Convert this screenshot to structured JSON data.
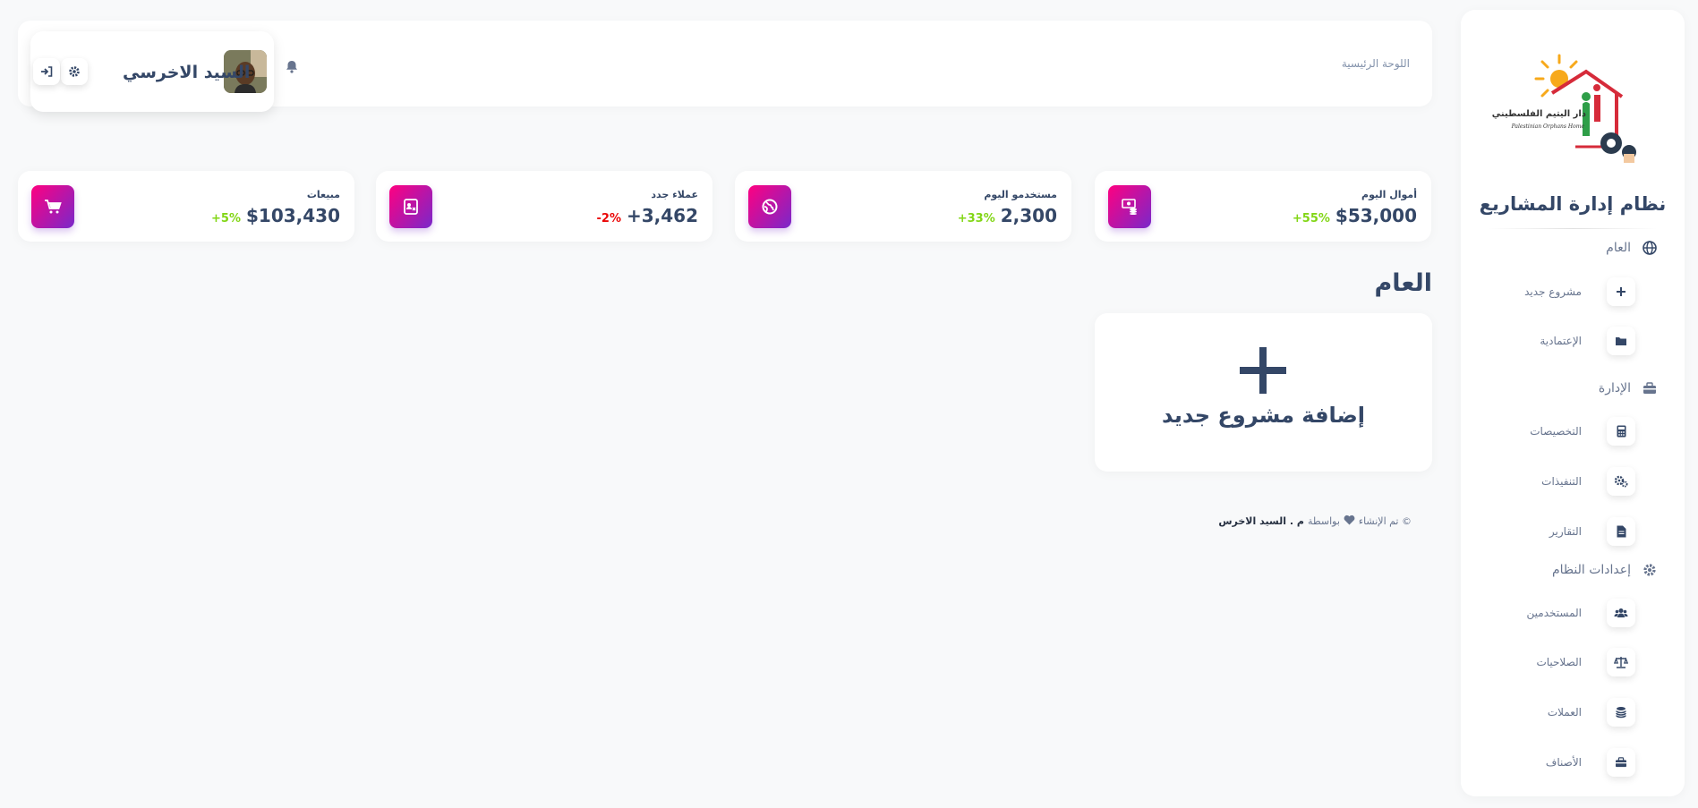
{
  "sidebar": {
    "logo": {
      "arabic_text": "دار اليتيم الفلسطيني",
      "english_text": "Palestinian Orphans Home"
    },
    "brand_title": "نظام إدارة المشاريع",
    "sections": [
      {
        "title": "العام",
        "icon": "globe-icon",
        "items": [
          {
            "label": "مشروع جديد",
            "icon": "plus-icon"
          },
          {
            "label": "الإعتمادية",
            "icon": "folder-icon"
          }
        ]
      },
      {
        "title": "الإدارة",
        "icon": "toolbox-icon",
        "items": [
          {
            "label": "التخصيصات",
            "icon": "calculator-icon"
          },
          {
            "label": "التنفيذات",
            "icon": "gears-icon"
          },
          {
            "label": "التقارير",
            "icon": "document-icon"
          }
        ]
      },
      {
        "title": "إعدادات النظام",
        "icon": "gear-icon",
        "items": [
          {
            "label": "المستخدمين",
            "icon": "users-icon"
          },
          {
            "label": "الصلاحيات",
            "icon": "scale-icon"
          },
          {
            "label": "العملات",
            "icon": "coins-icon"
          },
          {
            "label": "الأصناف",
            "icon": "toolbox-icon"
          }
        ]
      }
    ]
  },
  "topbar": {
    "breadcrumb": "اللوحة الرئيسية",
    "user_name": "السيد الاخرسي"
  },
  "stats": [
    {
      "title": "أموال اليوم",
      "value": "$53,000",
      "change": "+55%",
      "change_color": "#82d616",
      "icon": "money-icon"
    },
    {
      "title": "مستخدمو اليوم",
      "value": "2,300",
      "change": "+33%",
      "change_color": "#82d616",
      "icon": "globe-icon"
    },
    {
      "title": "عملاء جدد",
      "value": "+3,462",
      "change": "-2%",
      "change_color": "#ea0606",
      "icon": "id-card-icon"
    },
    {
      "title": "مبيعات",
      "value": "$103,430",
      "change": "+5%",
      "change_color": "#82d616",
      "icon": "cart-icon"
    }
  ],
  "main": {
    "section_title": "العام",
    "add_project_label": "إضافة مشروع جديد"
  },
  "footer": {
    "prefix": "© تم الإنشاء",
    "by": "بواسطة",
    "author": "م . السيد الاخرس"
  },
  "colors": {
    "accent_gradient_start": "#7928ca",
    "accent_gradient_end": "#ff0080",
    "text_dark": "#344767",
    "text_muted": "#67748e"
  }
}
